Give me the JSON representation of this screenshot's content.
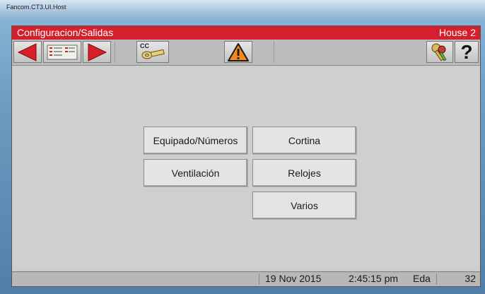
{
  "window": {
    "title": "Fancom.CT3.UI.Host"
  },
  "header": {
    "title": "Configuracion/Salidas",
    "house": "House 2"
  },
  "toolbar": {
    "prev_icon": "left-arrow-icon",
    "list_icon": "list-view-icon",
    "next_icon": "right-arrow-icon",
    "cc_label": "CC",
    "warning_icon": "warning-icon",
    "keys_icon": "keys-icon",
    "help_label": "?"
  },
  "menu": {
    "buttons": [
      {
        "label": "Equipado/Números"
      },
      {
        "label": "Cortina"
      },
      {
        "label": "Ventilación"
      },
      {
        "label": "Relojes"
      },
      {
        "label": "Varios"
      }
    ]
  },
  "status": {
    "date": "19 Nov 2015",
    "time": "2:45:15 pm",
    "user": "Eda",
    "day": "32"
  },
  "colors": {
    "header_red": "#d41f2e",
    "arrow_red": "#d8202a",
    "warning_orange": "#f08a1c"
  }
}
